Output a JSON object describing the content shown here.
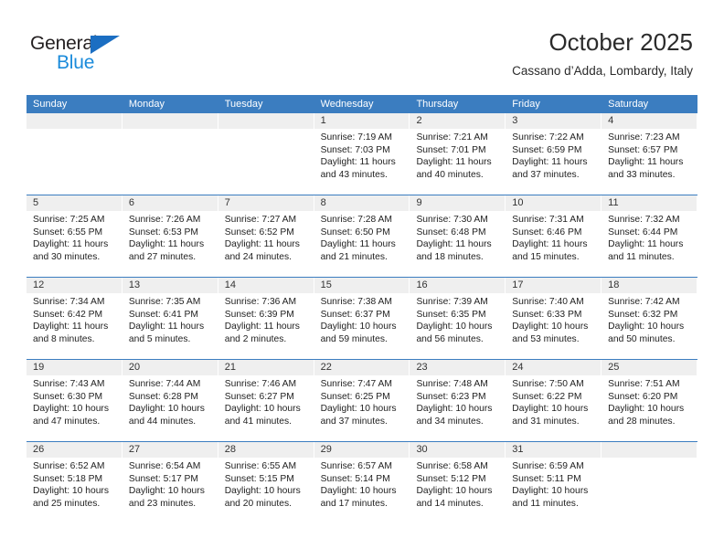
{
  "brand": {
    "name_top": "General",
    "name_bottom": "Blue",
    "triangle_color": "#1b6ec2",
    "bottom_color": "#1b8bdb"
  },
  "header": {
    "title": "October 2025",
    "subtitle": "Cassano d’Adda, Lombardy, Italy"
  },
  "theme": {
    "header_blue": "#3b7dc0",
    "daynum_bg": "#efefef",
    "text": "#222222"
  },
  "weekdays": [
    "Sunday",
    "Monday",
    "Tuesday",
    "Wednesday",
    "Thursday",
    "Friday",
    "Saturday"
  ],
  "labels": {
    "sunrise": "Sunrise:",
    "sunset": "Sunset:",
    "daylight": "Daylight:"
  },
  "weeks": [
    [
      {
        "blank": true
      },
      {
        "blank": true
      },
      {
        "blank": true
      },
      {
        "day": "1",
        "sunrise": "Sunrise: 7:19 AM",
        "sunset": "Sunset: 7:03 PM",
        "daylight_1": "Daylight: 11 hours",
        "daylight_2": "and 43 minutes."
      },
      {
        "day": "2",
        "sunrise": "Sunrise: 7:21 AM",
        "sunset": "Sunset: 7:01 PM",
        "daylight_1": "Daylight: 11 hours",
        "daylight_2": "and 40 minutes."
      },
      {
        "day": "3",
        "sunrise": "Sunrise: 7:22 AM",
        "sunset": "Sunset: 6:59 PM",
        "daylight_1": "Daylight: 11 hours",
        "daylight_2": "and 37 minutes."
      },
      {
        "day": "4",
        "sunrise": "Sunrise: 7:23 AM",
        "sunset": "Sunset: 6:57 PM",
        "daylight_1": "Daylight: 11 hours",
        "daylight_2": "and 33 minutes."
      }
    ],
    [
      {
        "day": "5",
        "sunrise": "Sunrise: 7:25 AM",
        "sunset": "Sunset: 6:55 PM",
        "daylight_1": "Daylight: 11 hours",
        "daylight_2": "and 30 minutes."
      },
      {
        "day": "6",
        "sunrise": "Sunrise: 7:26 AM",
        "sunset": "Sunset: 6:53 PM",
        "daylight_1": "Daylight: 11 hours",
        "daylight_2": "and 27 minutes."
      },
      {
        "day": "7",
        "sunrise": "Sunrise: 7:27 AM",
        "sunset": "Sunset: 6:52 PM",
        "daylight_1": "Daylight: 11 hours",
        "daylight_2": "and 24 minutes."
      },
      {
        "day": "8",
        "sunrise": "Sunrise: 7:28 AM",
        "sunset": "Sunset: 6:50 PM",
        "daylight_1": "Daylight: 11 hours",
        "daylight_2": "and 21 minutes."
      },
      {
        "day": "9",
        "sunrise": "Sunrise: 7:30 AM",
        "sunset": "Sunset: 6:48 PM",
        "daylight_1": "Daylight: 11 hours",
        "daylight_2": "and 18 minutes."
      },
      {
        "day": "10",
        "sunrise": "Sunrise: 7:31 AM",
        "sunset": "Sunset: 6:46 PM",
        "daylight_1": "Daylight: 11 hours",
        "daylight_2": "and 15 minutes."
      },
      {
        "day": "11",
        "sunrise": "Sunrise: 7:32 AM",
        "sunset": "Sunset: 6:44 PM",
        "daylight_1": "Daylight: 11 hours",
        "daylight_2": "and 11 minutes."
      }
    ],
    [
      {
        "day": "12",
        "sunrise": "Sunrise: 7:34 AM",
        "sunset": "Sunset: 6:42 PM",
        "daylight_1": "Daylight: 11 hours",
        "daylight_2": "and 8 minutes."
      },
      {
        "day": "13",
        "sunrise": "Sunrise: 7:35 AM",
        "sunset": "Sunset: 6:41 PM",
        "daylight_1": "Daylight: 11 hours",
        "daylight_2": "and 5 minutes."
      },
      {
        "day": "14",
        "sunrise": "Sunrise: 7:36 AM",
        "sunset": "Sunset: 6:39 PM",
        "daylight_1": "Daylight: 11 hours",
        "daylight_2": "and 2 minutes."
      },
      {
        "day": "15",
        "sunrise": "Sunrise: 7:38 AM",
        "sunset": "Sunset: 6:37 PM",
        "daylight_1": "Daylight: 10 hours",
        "daylight_2": "and 59 minutes."
      },
      {
        "day": "16",
        "sunrise": "Sunrise: 7:39 AM",
        "sunset": "Sunset: 6:35 PM",
        "daylight_1": "Daylight: 10 hours",
        "daylight_2": "and 56 minutes."
      },
      {
        "day": "17",
        "sunrise": "Sunrise: 7:40 AM",
        "sunset": "Sunset: 6:33 PM",
        "daylight_1": "Daylight: 10 hours",
        "daylight_2": "and 53 minutes."
      },
      {
        "day": "18",
        "sunrise": "Sunrise: 7:42 AM",
        "sunset": "Sunset: 6:32 PM",
        "daylight_1": "Daylight: 10 hours",
        "daylight_2": "and 50 minutes."
      }
    ],
    [
      {
        "day": "19",
        "sunrise": "Sunrise: 7:43 AM",
        "sunset": "Sunset: 6:30 PM",
        "daylight_1": "Daylight: 10 hours",
        "daylight_2": "and 47 minutes."
      },
      {
        "day": "20",
        "sunrise": "Sunrise: 7:44 AM",
        "sunset": "Sunset: 6:28 PM",
        "daylight_1": "Daylight: 10 hours",
        "daylight_2": "and 44 minutes."
      },
      {
        "day": "21",
        "sunrise": "Sunrise: 7:46 AM",
        "sunset": "Sunset: 6:27 PM",
        "daylight_1": "Daylight: 10 hours",
        "daylight_2": "and 41 minutes."
      },
      {
        "day": "22",
        "sunrise": "Sunrise: 7:47 AM",
        "sunset": "Sunset: 6:25 PM",
        "daylight_1": "Daylight: 10 hours",
        "daylight_2": "and 37 minutes."
      },
      {
        "day": "23",
        "sunrise": "Sunrise: 7:48 AM",
        "sunset": "Sunset: 6:23 PM",
        "daylight_1": "Daylight: 10 hours",
        "daylight_2": "and 34 minutes."
      },
      {
        "day": "24",
        "sunrise": "Sunrise: 7:50 AM",
        "sunset": "Sunset: 6:22 PM",
        "daylight_1": "Daylight: 10 hours",
        "daylight_2": "and 31 minutes."
      },
      {
        "day": "25",
        "sunrise": "Sunrise: 7:51 AM",
        "sunset": "Sunset: 6:20 PM",
        "daylight_1": "Daylight: 10 hours",
        "daylight_2": "and 28 minutes."
      }
    ],
    [
      {
        "day": "26",
        "sunrise": "Sunrise: 6:52 AM",
        "sunset": "Sunset: 5:18 PM",
        "daylight_1": "Daylight: 10 hours",
        "daylight_2": "and 25 minutes."
      },
      {
        "day": "27",
        "sunrise": "Sunrise: 6:54 AM",
        "sunset": "Sunset: 5:17 PM",
        "daylight_1": "Daylight: 10 hours",
        "daylight_2": "and 23 minutes."
      },
      {
        "day": "28",
        "sunrise": "Sunrise: 6:55 AM",
        "sunset": "Sunset: 5:15 PM",
        "daylight_1": "Daylight: 10 hours",
        "daylight_2": "and 20 minutes."
      },
      {
        "day": "29",
        "sunrise": "Sunrise: 6:57 AM",
        "sunset": "Sunset: 5:14 PM",
        "daylight_1": "Daylight: 10 hours",
        "daylight_2": "and 17 minutes."
      },
      {
        "day": "30",
        "sunrise": "Sunrise: 6:58 AM",
        "sunset": "Sunset: 5:12 PM",
        "daylight_1": "Daylight: 10 hours",
        "daylight_2": "and 14 minutes."
      },
      {
        "day": "31",
        "sunrise": "Sunrise: 6:59 AM",
        "sunset": "Sunset: 5:11 PM",
        "daylight_1": "Daylight: 10 hours",
        "daylight_2": "and 11 minutes."
      },
      {
        "blank": true
      }
    ]
  ]
}
